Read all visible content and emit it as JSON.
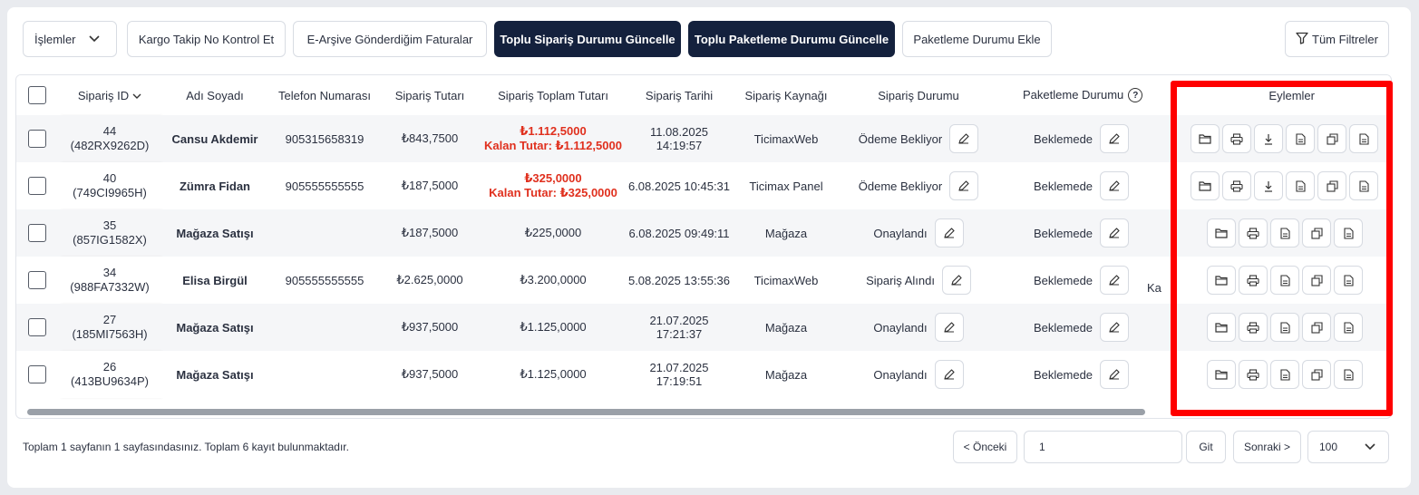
{
  "toolbar": {
    "actions_dropdown": "İşlemler",
    "btn_cargo_check": "Kargo Takip No Kontrol Et",
    "btn_earsiv": "E-Arşive Gönderdiğim Faturalar",
    "btn_bulk_order_status": "Toplu Sipariş Durumu Güncelle",
    "btn_bulk_package_status": "Toplu Paketleme Durumu Güncelle",
    "btn_add_package_status": "Paketleme Durumu Ekle",
    "btn_all_filters": "Tüm Filtreler"
  },
  "table": {
    "headers": {
      "order_id": "Sipariş ID",
      "name": "Adı Soyadı",
      "phone": "Telefon Numarası",
      "amount": "Sipariş Tutarı",
      "total": "Sipariş Toplam Tutarı",
      "date": "Sipariş Tarihi",
      "source": "Sipariş Kaynağı",
      "status": "Sipariş Durumu",
      "package_status": "Paketleme Durumu",
      "actions": "Eylemler"
    },
    "rows": [
      {
        "id": "44",
        "code": "(482RX9262D)",
        "name": "Cansu Akdemir",
        "phone": "905315658319",
        "amount": "₺843,7500",
        "total": "₺1.112,5000",
        "remaining": "Kalan Tutar: ₺1.112,5000",
        "date": "11.08.2025 14:19:57",
        "source": "TicimaxWeb",
        "status": "Ödeme Bekliyor",
        "package": "Beklemede"
      },
      {
        "id": "40",
        "code": "(749CI9965H)",
        "name": "Zümra Fidan",
        "phone": "905555555555",
        "amount": "₺187,5000",
        "total": "₺325,0000",
        "remaining": "Kalan Tutar: ₺325,0000",
        "date": "6.08.2025 10:45:31",
        "source": "Ticimax Panel",
        "status": "Ödeme Bekliyor",
        "package": "Beklemede"
      },
      {
        "id": "35",
        "code": "(857IG1582X)",
        "name": "Mağaza Satışı",
        "phone": "",
        "amount": "₺187,5000",
        "total": "₺225,0000",
        "remaining": "",
        "date": "6.08.2025 09:49:11",
        "source": "Mağaza",
        "status": "Onaylandı",
        "package": "Beklemede"
      },
      {
        "id": "34",
        "code": "(988FA7332W)",
        "name": "Elisa Birgül",
        "phone": "905555555555",
        "amount": "₺2.625,0000",
        "total": "₺3.200,0000",
        "remaining": "",
        "date": "5.08.2025 13:55:36",
        "source": "TicimaxWeb",
        "status": "Sipariş Alındı",
        "package": "Beklemede"
      },
      {
        "id": "27",
        "code": "(185MI7563H)",
        "name": "Mağaza Satışı",
        "phone": "",
        "amount": "₺937,5000",
        "total": "₺1.125,0000",
        "remaining": "",
        "date": "21.07.2025 17:21:37",
        "source": "Mağaza",
        "status": "Onaylandı",
        "package": "Beklemede"
      },
      {
        "id": "26",
        "code": "(413BU9634P)",
        "name": "Mağaza Satışı",
        "phone": "",
        "amount": "₺937,5000",
        "total": "₺1.125,0000",
        "remaining": "",
        "date": "21.07.2025 17:19:51",
        "source": "Mağaza",
        "status": "Onaylandı",
        "package": "Beklemede"
      }
    ],
    "overflow_fragment": "Ka"
  },
  "footer": {
    "summary": "Toplam 1 sayfanın 1 sayfasındasınız. Toplam 6 kayıt bulunmaktadır.",
    "prev": "< Önceki",
    "page_value": "1",
    "go": "Git",
    "next": "Sonraki >",
    "page_size": "100"
  },
  "colors": {
    "dark_button": "#14213d",
    "remaining_red": "#e0301e",
    "highlight": "#ff0000"
  }
}
